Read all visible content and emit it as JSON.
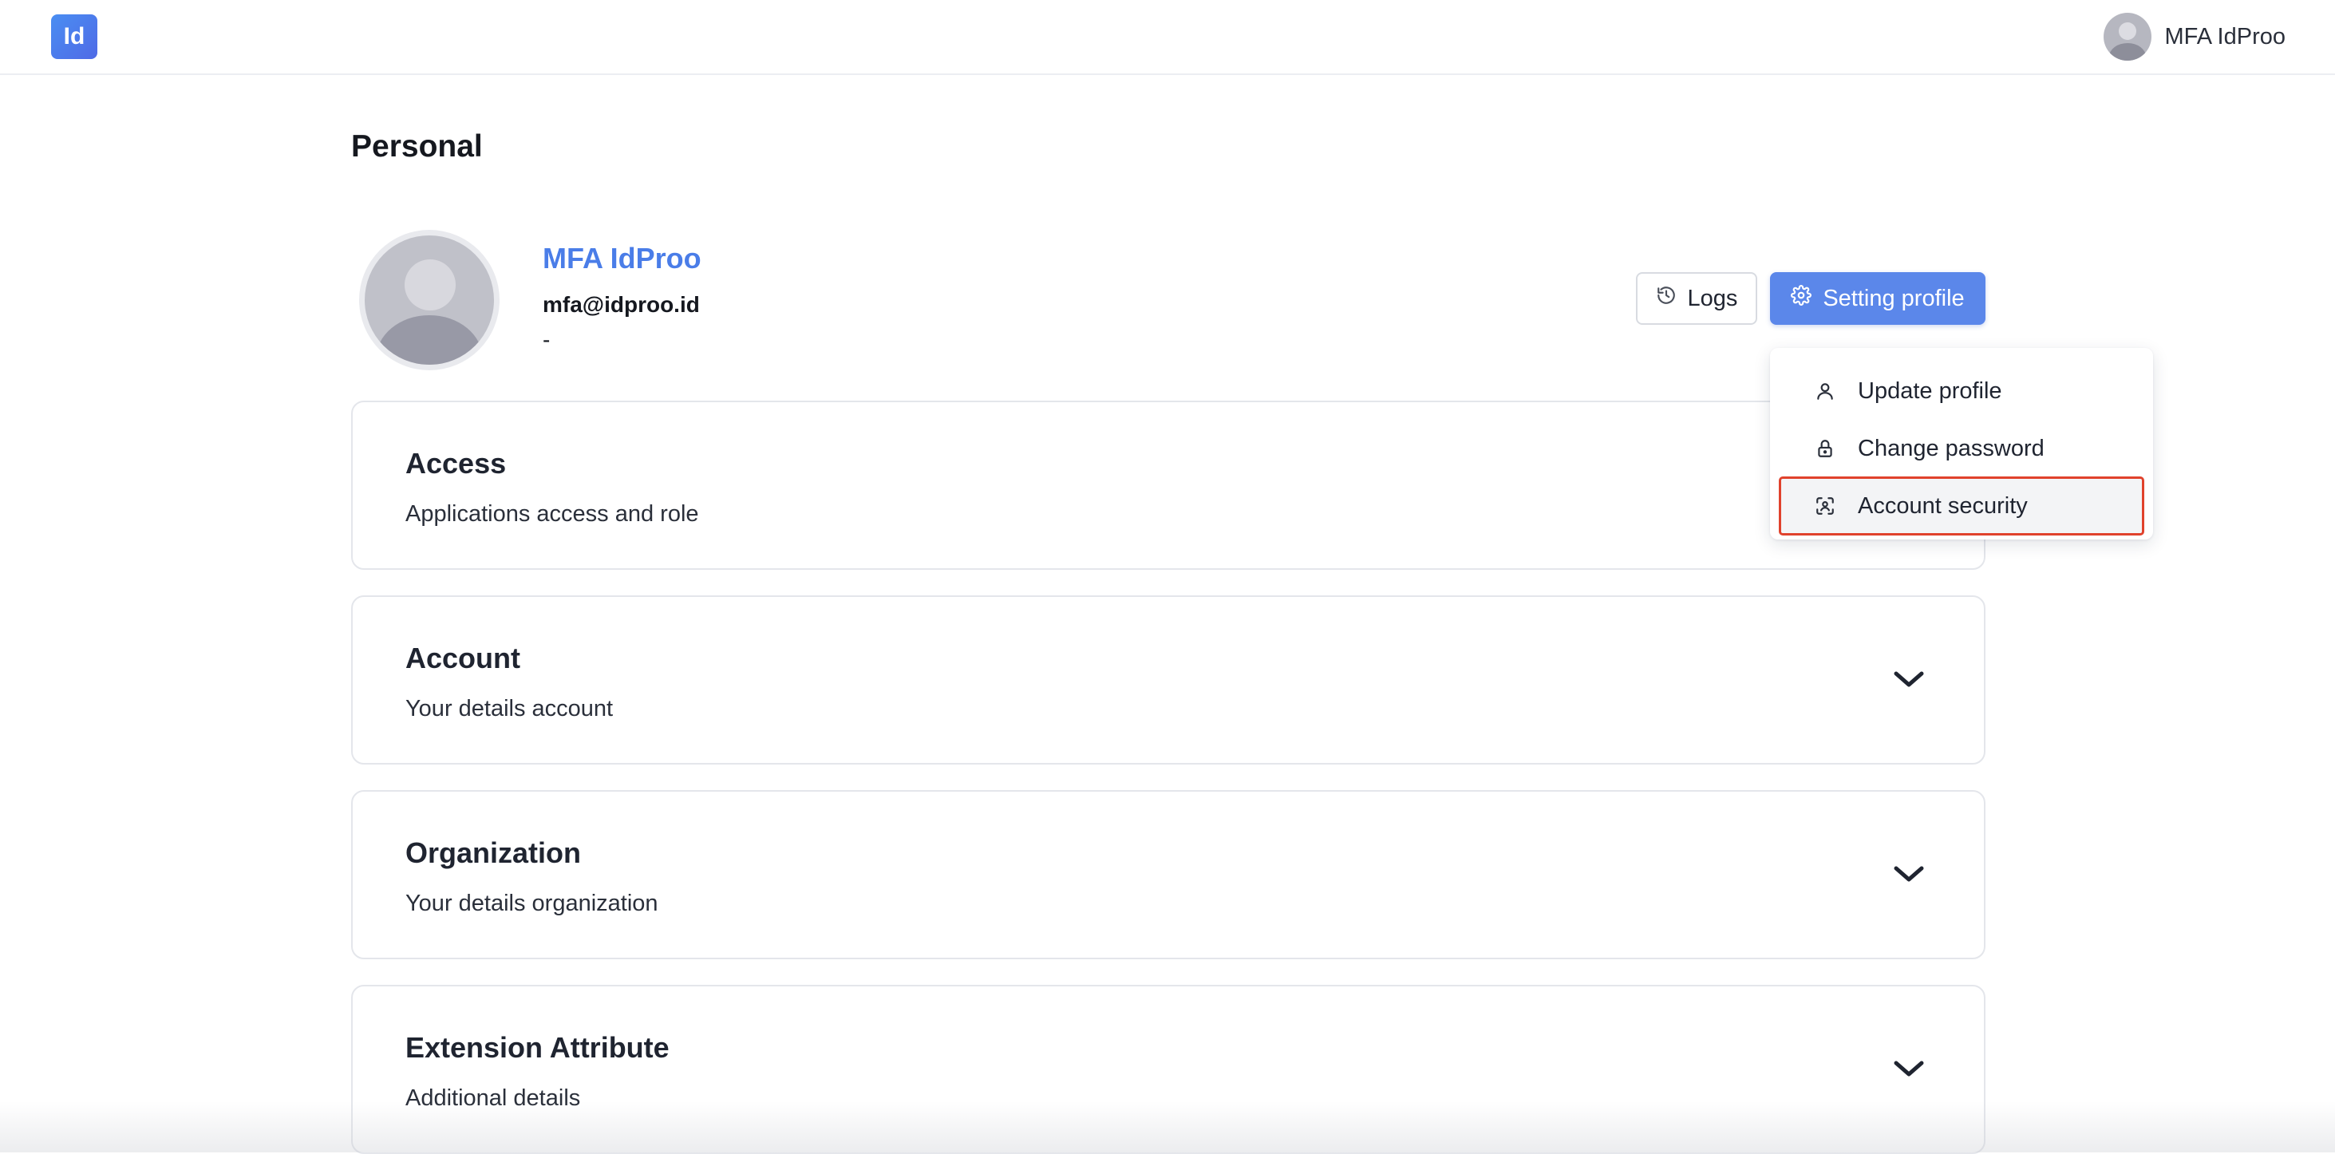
{
  "header": {
    "logo_text": "Id",
    "user_name": "MFA IdProo"
  },
  "page": {
    "title": "Personal"
  },
  "profile": {
    "name": "MFA IdProo",
    "email": "mfa@idproo.id",
    "extra": "-"
  },
  "actions": {
    "logs_label": "Logs",
    "setting_label": "Setting profile"
  },
  "dropdown": {
    "items": [
      {
        "label": "Update profile",
        "icon": "user-icon"
      },
      {
        "label": "Change password",
        "icon": "lock-icon"
      },
      {
        "label": "Account security",
        "icon": "scan-face-icon",
        "highlighted": true
      }
    ]
  },
  "sections": [
    {
      "title": "Access",
      "subtitle": "Applications access and role"
    },
    {
      "title": "Account",
      "subtitle": "Your details account"
    },
    {
      "title": "Organization",
      "subtitle": "Your details organization"
    },
    {
      "title": "Extension Attribute",
      "subtitle": "Additional details"
    }
  ],
  "colors": {
    "accent": "#5b87ea",
    "name_link": "#4a7de8",
    "highlight_border": "#e0422c"
  }
}
